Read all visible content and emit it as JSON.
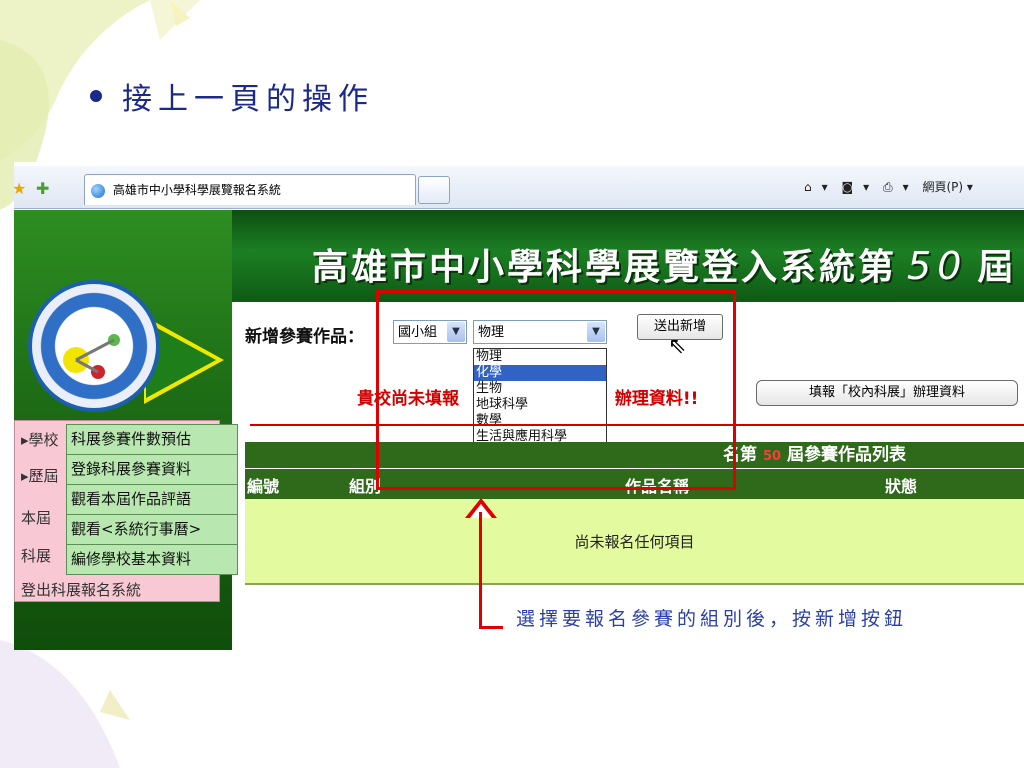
{
  "slide": {
    "title": "接上一頁的操作",
    "annotation": "選擇要報名參賽的組別後，按新增按鈕"
  },
  "browser": {
    "tab_title": "高雄市中小學科學展覽報名系統",
    "tools": [
      "▾",
      "▾",
      "▾",
      "網頁(P) ▾"
    ]
  },
  "header": {
    "title": "高雄市中小學科學展覽登入系統第",
    "edition": "50",
    "suffix": "屆"
  },
  "sidebar": {
    "back_menu": [
      "▸學校",
      "▸歷屆",
      "本屆",
      "科展",
      "登出科展報名系統"
    ],
    "popup_menu": [
      "科展參賽件數預估",
      "登錄科展參賽資料",
      "觀看本屆作品評語",
      "觀看<系統行事曆>",
      "編修學校基本資料"
    ]
  },
  "form": {
    "label": "新增參賽作品：",
    "level_select": "國小組",
    "subject_select": "物理",
    "subject_options": [
      "物理",
      "化學",
      "生物",
      "地球科學",
      "數學",
      "生活與應用科學"
    ],
    "highlighted_option": "化學",
    "submit_button": "送出新增",
    "warning": "貴校尚未填報",
    "warning_tail": "辦理資料!!",
    "report_button": "填報「校內科展」辦理資料"
  },
  "table": {
    "title_prefix": "名第",
    "edition": "50",
    "title_suffix": "屆參賽作品列表",
    "columns": [
      "編號",
      "組別",
      "作品名稱",
      "狀態"
    ],
    "empty_text": "尚未報名任何項目"
  }
}
